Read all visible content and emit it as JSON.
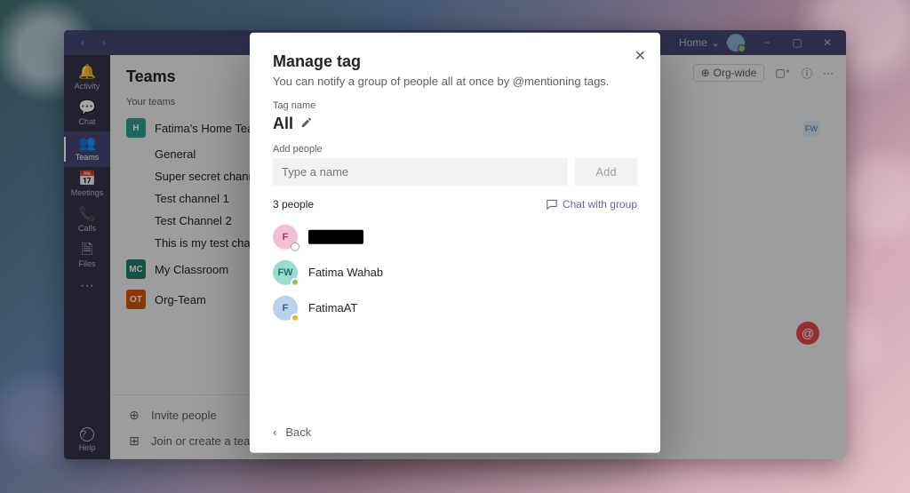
{
  "titlebar": {
    "home": "Home",
    "minimize": "−",
    "maximize": "▢",
    "close": "✕"
  },
  "rail": [
    {
      "icon": "🔔",
      "label": "Activity"
    },
    {
      "icon": "💬",
      "label": "Chat"
    },
    {
      "icon": "👥",
      "label": "Teams"
    },
    {
      "icon": "📅",
      "label": "Meetings"
    },
    {
      "icon": "📞",
      "label": "Calls"
    },
    {
      "icon": "🗎",
      "label": "Files"
    }
  ],
  "rail_more": "···",
  "rail_help": {
    "icon": "?",
    "label": "Help"
  },
  "teams_pane": {
    "heading": "Teams",
    "section": "Your teams",
    "teams": [
      {
        "badge": "H",
        "color": "#2e9e8f",
        "name": "Fatima's Home Team",
        "channels": [
          "General",
          "Super secret channel",
          "Test channel 1",
          "Test Channel 2",
          "This is my test channel"
        ]
      },
      {
        "badge": "MC",
        "color": "#217a6b",
        "name": "My Classroom",
        "channels": []
      },
      {
        "badge": "OT",
        "color": "#d0540a",
        "name": "Org-Team",
        "channels": []
      }
    ],
    "invite": "Invite people",
    "join": "Join or create a team"
  },
  "topbar": {
    "orgwide": "Org-wide",
    "mini_av": "FW"
  },
  "modal": {
    "title": "Manage tag",
    "subtitle": "You can notify a group of people all at once by @mentioning tags.",
    "tag_name_label": "Tag name",
    "tag_name": "All",
    "add_people_label": "Add people",
    "placeholder": "Type a name",
    "add_btn": "Add",
    "count": "3 people",
    "chat_link": "Chat with group",
    "members": [
      {
        "initials": "F",
        "bg": "#f1c0d5",
        "fg": "#a0396d",
        "presence": "#d1d1d1",
        "presence_kind": "offline",
        "name": "__REDACTED__"
      },
      {
        "initials": "FW",
        "bg": "#97ded1",
        "fg": "#2a6e60",
        "presence": "#92c353",
        "presence_kind": "available",
        "name": "Fatima Wahab"
      },
      {
        "initials": "F",
        "bg": "#b9d3ec",
        "fg": "#3a5e86",
        "presence": "#f3b816",
        "presence_kind": "away",
        "name": "FatimaAT"
      }
    ],
    "back": "Back"
  }
}
